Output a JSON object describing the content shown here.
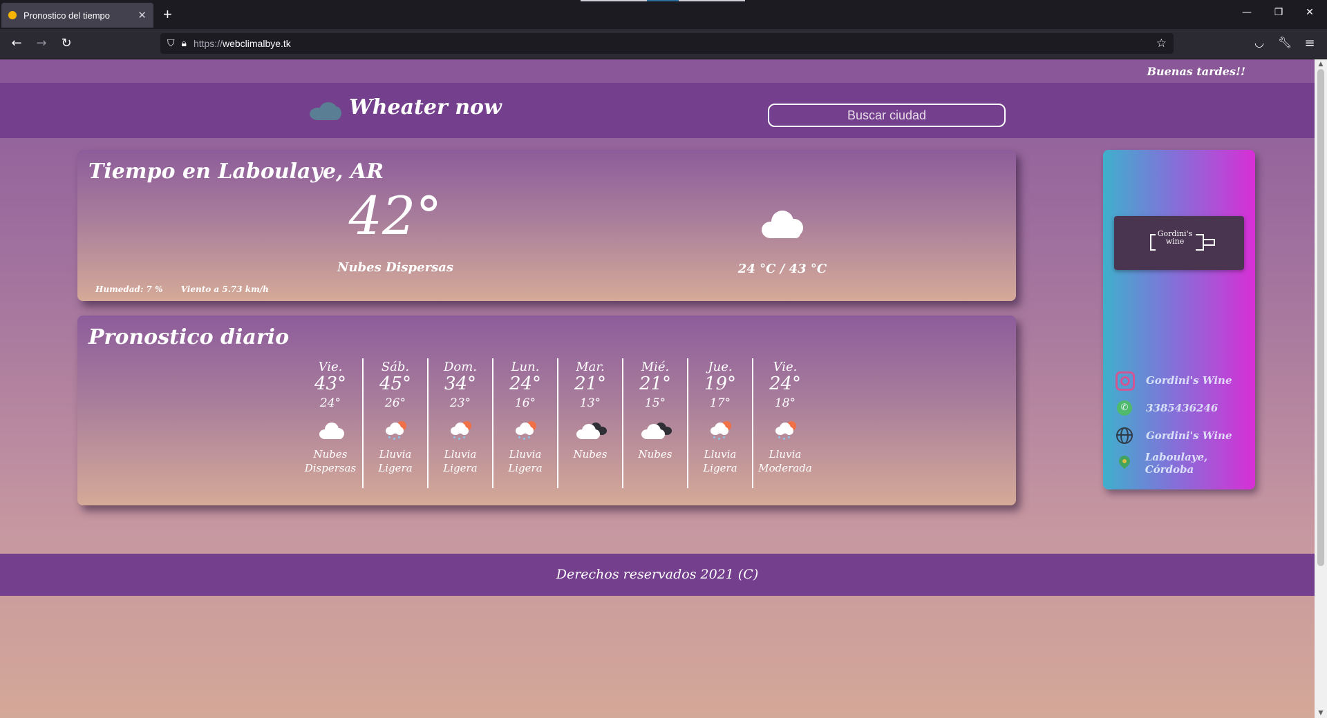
{
  "browser": {
    "tab_title": "Pronostico del tiempo",
    "tab_close": "✕",
    "new_tab": "+",
    "url_protocol": "https://",
    "url_host": "webclimalbye.tk"
  },
  "page": {
    "greeting": "Buenas tardes!!",
    "brand": "Wheater now",
    "search_placeholder": "Buscar ciudad",
    "current": {
      "title": "Tiempo en Laboulaye, AR",
      "temp": "42°",
      "description": "Nubes Dispersas",
      "humidity": "Humedad: 7 %",
      "wind": "Viento a 5.73 km/h",
      "minmax": "24 °C / 43 °C",
      "icon": "cloud-icon"
    },
    "daily": {
      "title": "Pronostico diario",
      "days": [
        {
          "day": "Vie.",
          "max": "43°",
          "min": "24°",
          "desc_1": "Nubes",
          "desc_2": "Dispersas",
          "icon": "cloud-icon"
        },
        {
          "day": "Sáb.",
          "max": "45°",
          "min": "26°",
          "desc_1": "Lluvia",
          "desc_2": "Ligera",
          "icon": "sun-rain-icon"
        },
        {
          "day": "Dom.",
          "max": "34°",
          "min": "23°",
          "desc_1": "Lluvia",
          "desc_2": "Ligera",
          "icon": "sun-rain-icon"
        },
        {
          "day": "Lun.",
          "max": "24°",
          "min": "16°",
          "desc_1": "Lluvia",
          "desc_2": "Ligera",
          "icon": "sun-rain-icon"
        },
        {
          "day": "Mar.",
          "max": "21°",
          "min": "13°",
          "desc_1": "Nubes",
          "desc_2": "",
          "icon": "dark-clouds-icon"
        },
        {
          "day": "Mié.",
          "max": "21°",
          "min": "15°",
          "desc_1": "Nubes",
          "desc_2": "",
          "icon": "dark-clouds-icon"
        },
        {
          "day": "Jue.",
          "max": "19°",
          "min": "17°",
          "desc_1": "Lluvia",
          "desc_2": "Ligera",
          "icon": "sun-rain-icon"
        },
        {
          "day": "Vie.",
          "max": "24°",
          "min": "18°",
          "desc_1": "Lluvia",
          "desc_2": "Moderada",
          "icon": "sun-rain-icon"
        }
      ]
    },
    "ad": {
      "name_1": "Gordini's",
      "name_2": "wine"
    },
    "contacts": [
      {
        "label": "Gordini's Wine",
        "icon": "instagram-icon"
      },
      {
        "label": "3385436246",
        "icon": "whatsapp-icon"
      },
      {
        "label": "Gordini's Wine",
        "icon": "globe-icon"
      },
      {
        "label": "Laboulaye, Córdoba",
        "icon": "map-pin-icon"
      }
    ],
    "footer": "Derechos reservados 2021 (C)"
  },
  "colors": {
    "header": "#743f8c",
    "greet_bar": "#8a5898",
    "card_top": "#8d5c9b",
    "card_bottom": "#d5aa98",
    "sidebar_left": "#3fb0cc",
    "sidebar_right": "#d82ed6"
  }
}
